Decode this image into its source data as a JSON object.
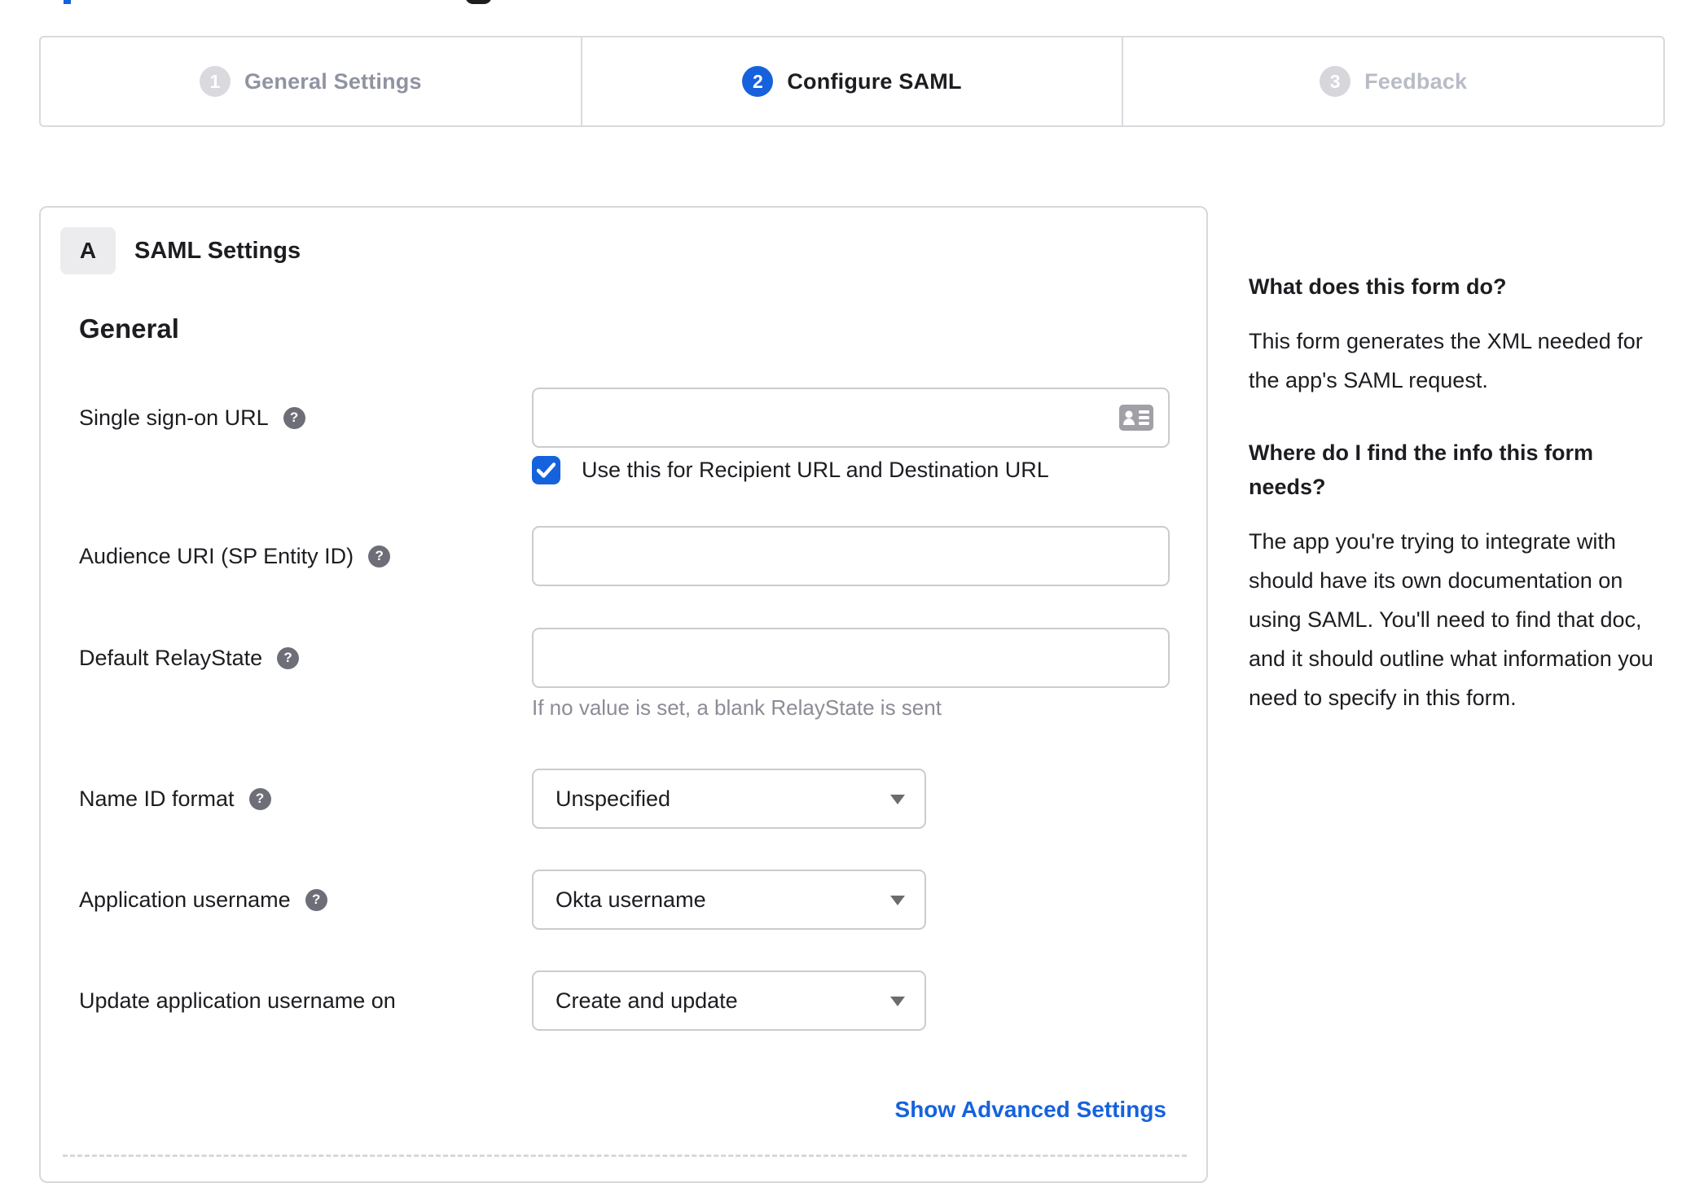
{
  "colors": {
    "accent_blue": "#1662dd",
    "text_dark": "#1d1d21",
    "muted_gray": "#8c8c96",
    "border_gray": "#d8d8dc"
  },
  "stepper": {
    "steps": [
      {
        "number": "1",
        "label": "General Settings",
        "state": "complete"
      },
      {
        "number": "2",
        "label": "Configure SAML",
        "state": "active"
      },
      {
        "number": "3",
        "label": "Feedback",
        "state": "upcoming"
      }
    ]
  },
  "panel": {
    "badge": "A",
    "title": "SAML Settings",
    "section_heading": "General",
    "fields": [
      {
        "label": "Single sign-on URL",
        "type": "text",
        "value": "",
        "checkbox_label": "Use this for Recipient URL and Destination URL",
        "checkbox_checked": true
      },
      {
        "label": "Audience URI (SP Entity ID)",
        "type": "text",
        "value": ""
      },
      {
        "label": "Default RelayState",
        "type": "text",
        "value": "",
        "hint": "If no value is set, a blank RelayState is sent"
      },
      {
        "label": "Name ID format",
        "type": "select",
        "value": "Unspecified"
      },
      {
        "label": "Application username",
        "type": "select",
        "value": "Okta username"
      },
      {
        "label": "Update application username on",
        "type": "select",
        "value": "Create and update"
      }
    ],
    "advanced_link": "Show Advanced Settings"
  },
  "sidebar": {
    "sections": [
      {
        "heading": "What does this form do?",
        "body": "This form generates the XML needed for the app's SAML request."
      },
      {
        "heading": "Where do I find the info this form needs?",
        "body": "The app you're trying to integrate with should have its own documentation on using SAML. You'll need to find that doc, and it should outline what information you need to specify in this form."
      }
    ]
  }
}
